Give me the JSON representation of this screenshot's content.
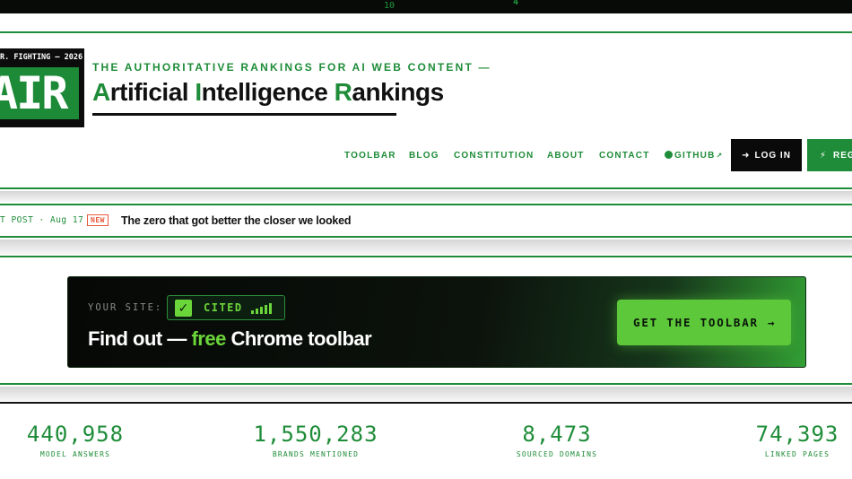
{
  "topstrip": {
    "digits": [
      "10",
      "4"
    ]
  },
  "header": {
    "logo": {
      "tag": "R. FIGHTING — 2026",
      "mark": "AIR"
    },
    "tagline": "THE AUTHORITATIVE RANKINGS FOR AI WEB CONTENT —",
    "title": {
      "w1_first": "A",
      "w1_rest": "rtificial",
      "w2_first": "I",
      "w2_rest": "ntelligence",
      "w3_first": "R",
      "w3_rest": "ankings"
    },
    "nav": {
      "toolbar": "TOOLBAR",
      "blog": "BLOG",
      "constitution": "CONSTITUTION",
      "about": "ABOUT",
      "contact": "CONTACT",
      "github": "GITHUB"
    },
    "login_label": "LOG IN",
    "register_label": "REG"
  },
  "ticker": {
    "label": "T POST · Aug 17",
    "badge": "NEW",
    "headline": "The zero that got better the closer we looked"
  },
  "promo": {
    "label": "YOUR SITE:",
    "status": "CITED",
    "title_start": "Find out — ",
    "title_highlight": "free",
    "title_end": " Chrome toolbar",
    "cta": "GET THE TOOLBAR",
    "cta_arrow": "→"
  },
  "stats": [
    {
      "value": "440,958",
      "label": "MODEL ANSWERS"
    },
    {
      "value": "1,550,283",
      "label": "BRANDS MENTIONED"
    },
    {
      "value": "8,473",
      "label": "SOURCED DOMAINS"
    },
    {
      "value": "74,393",
      "label": "LINKED PAGES"
    }
  ],
  "colors": {
    "brand_green": "#1e8c38",
    "accent_green": "#6bd63a",
    "badge_red": "#e85a3c",
    "dark": "#0a0a0a"
  }
}
